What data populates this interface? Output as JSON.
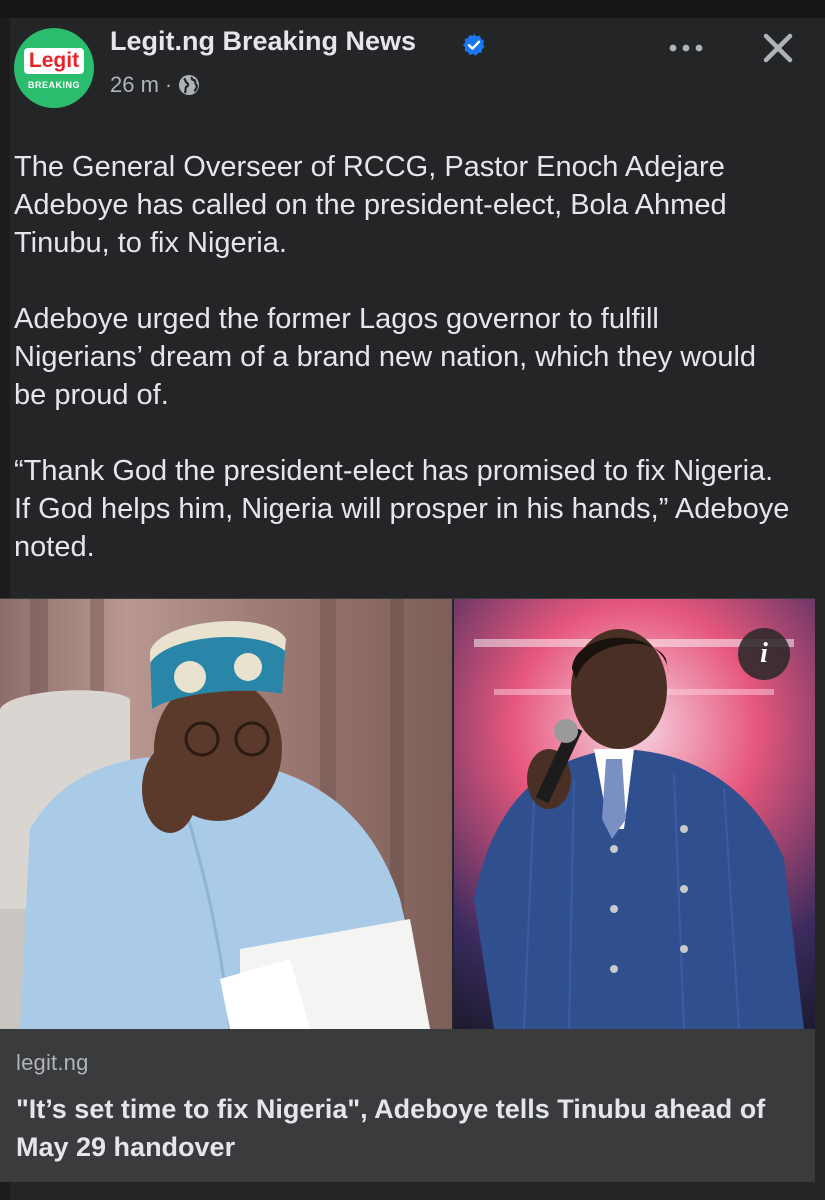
{
  "post": {
    "page_name": "Legit.ng Breaking News",
    "time": "26 m",
    "separator": "·",
    "avatar": {
      "logo_text": "Legit",
      "sub_text": "BREAKING"
    },
    "paragraphs": [
      "The General Overseer of RCCG, Pastor Enoch Adejare Adeboye has called on the president-elect, Bola Ahmed Tinubu, to fix Nigeria.",
      "Adeboye urged the former Lagos governor to fulfill Nigerians’ dream of a brand new nation, which they would be proud of.",
      "“Thank God the president-elect has promised to fix Nigeria. If God helps him, Nigeria will prosper in his hands,” Adeboye noted."
    ],
    "info_icon_glyph": "i"
  },
  "link_preview": {
    "domain": "legit.ng",
    "title": "\"It’s set time to fix Nigeria\", Adeboye tells Tinubu ahead of May 29 handover"
  },
  "colors": {
    "background": "#242526",
    "text": "#e4e6eb",
    "secondary_text": "#b0b3b8",
    "verified_blue": "#1877f2",
    "avatar_green": "#2bbd6e",
    "logo_red": "#e8232a",
    "preview_bg": "#3a3b3c"
  },
  "icons": [
    "verified-badge-icon",
    "globe-icon",
    "more-options-icon",
    "close-icon",
    "info-icon"
  ]
}
